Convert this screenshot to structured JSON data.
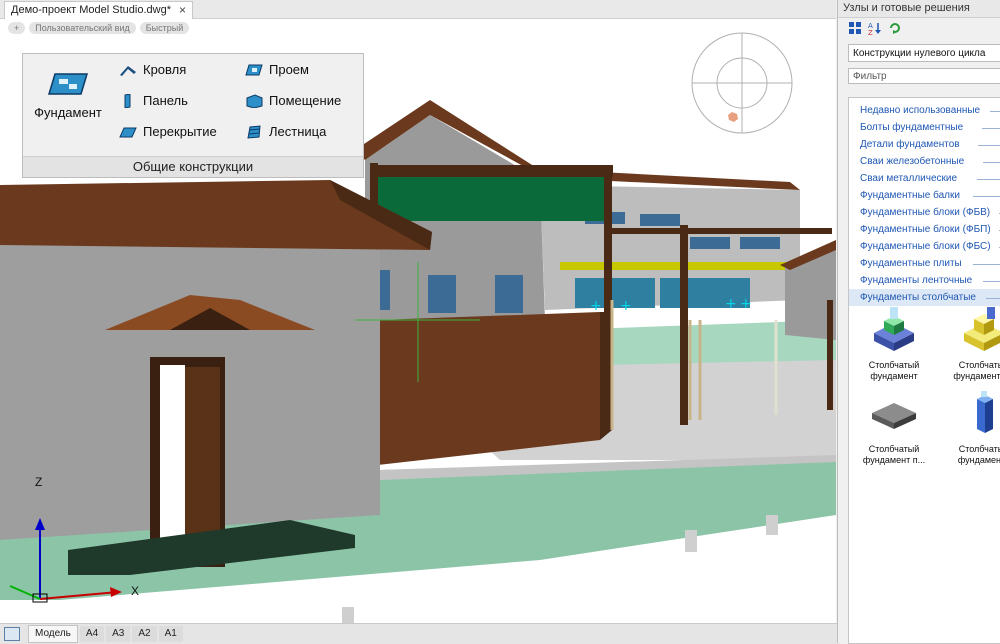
{
  "document": {
    "tab_title": "Демо-проект Model Studio.dwg*",
    "close_glyph": "×"
  },
  "viewport": {
    "pills": [
      "+",
      "Пользовательский вид",
      "Быстрый"
    ],
    "axis": {
      "z": "Z",
      "x": "X"
    }
  },
  "ribbon": {
    "big_button": "Фундамент",
    "items": [
      "Кровля",
      "Проем",
      "Панель",
      "Помещение",
      "Перекрытие",
      "Лестница"
    ],
    "group_title": "Общие конструкции"
  },
  "layout_tabs": [
    "Модель",
    "A4",
    "A3",
    "A2",
    "A1"
  ],
  "side_panel": {
    "title": "Узлы и готовые решения",
    "select_value": "Конструкции нулевого цикла",
    "filter_placeholder": "Фильтр",
    "categories": [
      "Недавно использованные",
      "Болты фундаментные",
      "Детали фундаментов",
      "Сваи железобетонные",
      "Сваи металлические",
      "Фундаментные балки",
      "Фундаментные блоки (ФБВ)",
      "Фундаментные блоки (ФБП)",
      "Фундаментные блоки (ФБС)",
      "Фундаментные плиты",
      "Фундаменты ленточные",
      "Фундаменты столбчатые"
    ],
    "items": [
      {
        "line1": "Столбчатый",
        "line2": "фундамент"
      },
      {
        "line1": "Столбчатый",
        "line2": "фундамент Ос"
      },
      {
        "line1": "Столбчатый",
        "line2": "фундамент п..."
      },
      {
        "line1": "Столбчатый",
        "line2": "фундамент_"
      }
    ]
  },
  "colors": {
    "accent": "#1f57b4",
    "roof": "#6b3a1e",
    "sign": "#0b6a3a",
    "ground": "#8cc4a8"
  }
}
